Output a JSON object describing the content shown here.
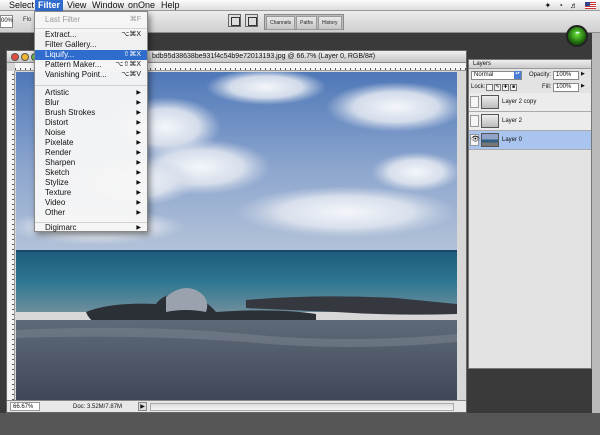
{
  "menubar": {
    "items": [
      "Select",
      "Filter",
      "View",
      "Window",
      "onOne",
      "Help"
    ],
    "active": "Filter"
  },
  "options_bar": {
    "zoom_value": "00%",
    "flow_label": "Flo",
    "palette_tabs": [
      "Channels",
      "Paths",
      "History"
    ]
  },
  "filter_menu": {
    "last_filter": {
      "label": "Last Filter",
      "shortcut": "⌘F"
    },
    "group1": [
      {
        "label": "Extract...",
        "shortcut": "⌥⌘X"
      },
      {
        "label": "Filter Gallery...",
        "shortcut": ""
      },
      {
        "label": "Liquify...",
        "shortcut": "⇧⌘X"
      },
      {
        "label": "Pattern Maker...",
        "shortcut": "⌥⇧⌘X"
      },
      {
        "label": "Vanishing Point...",
        "shortcut": "⌥⌘V"
      }
    ],
    "submenus": [
      "Artistic",
      "Blur",
      "Brush Strokes",
      "Distort",
      "Noise",
      "Pixelate",
      "Render",
      "Sharpen",
      "Sketch",
      "Stylize",
      "Texture",
      "Video",
      "Other"
    ],
    "plugins": [
      "Digimarc"
    ],
    "highlighted": "Liquify..."
  },
  "document": {
    "title": "bdb95d38638be931f4c54b9e72013193.jpg @ 66.7% (Layer 0, RGB/8#)",
    "zoom_readout": "66.67%",
    "doc_size": "Doc: 3.52M/7.87M"
  },
  "layers_panel": {
    "tab": "Layers",
    "blend_mode": "Normal",
    "opacity_label": "Opacity:",
    "opacity_value": "100%",
    "lock_label": "Lock:",
    "fill_label": "Fill:",
    "fill_value": "100%",
    "layers": [
      {
        "name": "Layer 2 copy",
        "visible": false,
        "selected": false
      },
      {
        "name": "Layer 2",
        "visible": false,
        "selected": false
      },
      {
        "name": "Layer 0",
        "visible": true,
        "selected": true
      }
    ]
  },
  "colors": {
    "menu_highlight": "#2f6ccd",
    "selected_layer": "#a9c4ee"
  }
}
